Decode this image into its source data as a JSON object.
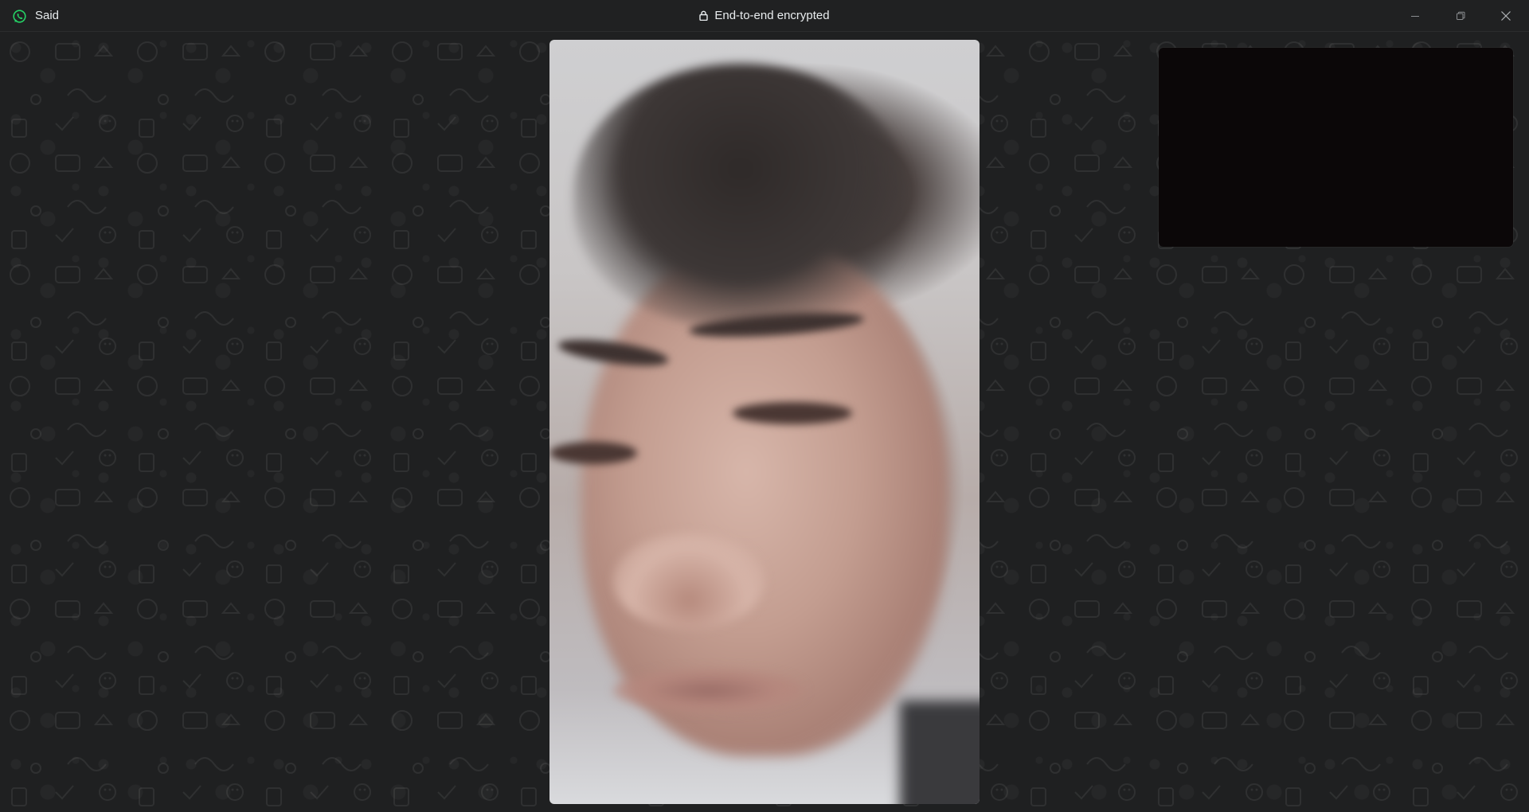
{
  "window": {
    "contact_name": "Said",
    "encryption_label": "End-to-end encrypted",
    "app_icon": "whatsapp-icon",
    "controls": [
      "minimize-icon",
      "restore-icon",
      "close-icon"
    ]
  },
  "call": {
    "remote_video": "remote participant video feed",
    "self_preview": "local camera preview"
  },
  "colors": {
    "brand": "#25d366",
    "background": "#1f2021",
    "titlebar": "#202122",
    "text": "#e9edef"
  }
}
